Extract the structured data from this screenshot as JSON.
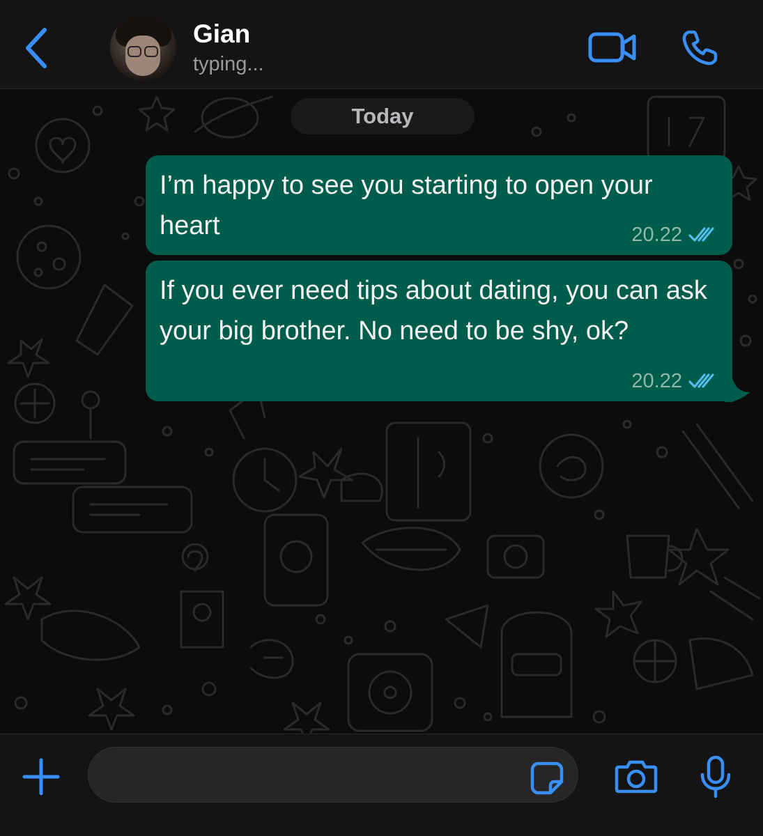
{
  "header": {
    "contact_name": "Gian",
    "status": "typing..."
  },
  "chat": {
    "date_label": "Today",
    "messages": [
      {
        "text": "I’m happy to see you starting to open your heart",
        "time": "20.22",
        "read": true
      },
      {
        "text": "If you ever need tips about dating, you can ask your big brother. No need to be shy, ok?",
        "time": "20.22",
        "read": true
      }
    ]
  },
  "composer": {
    "value": "",
    "placeholder": ""
  },
  "colors": {
    "accent": "#3a8ff5",
    "bubble_out": "#005c4b",
    "tick_read": "#53bdeb",
    "header_bg": "#141415"
  },
  "icons": [
    "back-chevron-icon",
    "video-call-icon",
    "phone-icon",
    "plus-icon",
    "sticker-icon",
    "camera-icon",
    "microphone-icon"
  ]
}
